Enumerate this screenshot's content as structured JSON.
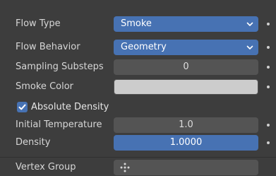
{
  "flow_type": {
    "label": "Flow Type",
    "value": "Smoke"
  },
  "flow_behavior": {
    "label": "Flow Behavior",
    "value": "Geometry"
  },
  "sampling_substeps": {
    "label": "Sampling Substeps",
    "value": "0"
  },
  "smoke_color": {
    "label": "Smoke Color",
    "color": "#cccccc"
  },
  "absolute_density": {
    "label": "Absolute Density",
    "checked": true
  },
  "initial_temperature": {
    "label": "Initial Temperature",
    "value": "1.0"
  },
  "density": {
    "label": "Density",
    "value": "1.0000"
  },
  "vertex_group": {
    "label": "Vertex Group",
    "icon": "vertex-group-icon"
  },
  "colors": {
    "accent": "#4772b3",
    "field": "#545454",
    "background": "#3d3d3d"
  }
}
